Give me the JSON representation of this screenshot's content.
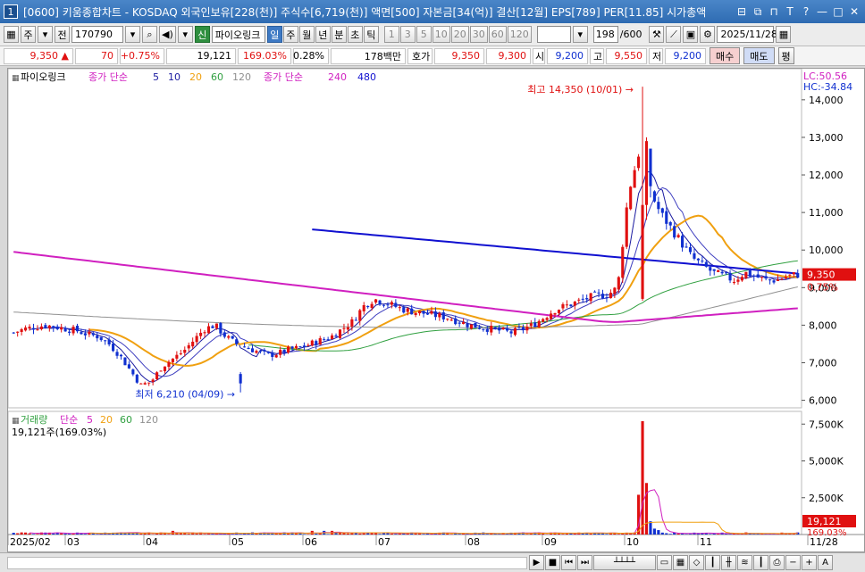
{
  "window": {
    "number": "1",
    "title": "[0600] 키움종합차트 - KOSDAQ 외국인보유[228(천)] 주식수[6,719(천)] 액면[500] 자본금[34(억)] 결산[12월] EPS[789] PER[11.85] 시가총액",
    "buttons": [
      "⊟",
      "⧉",
      "⊓",
      "T",
      "?",
      "—",
      "□",
      "✕"
    ]
  },
  "toolbar": {
    "market_btn": "주",
    "prev_btn": "전",
    "stock_code": "170790",
    "badge_new": "신",
    "stock_name": "파이오링크",
    "periods": [
      "일",
      "주",
      "월",
      "년",
      "분",
      "초",
      "틱"
    ],
    "selected_period": "일",
    "intervals": [
      "1",
      "3",
      "5",
      "10",
      "20",
      "30",
      "60",
      "120"
    ],
    "count_display": "198",
    "count_total": "/600",
    "date_value": "2025/11/28"
  },
  "quote": {
    "price": "9,350",
    "arrow": "▲",
    "change": "70",
    "change_pct": "+0.75%",
    "volume": "19,121",
    "vol_ratio": "169.03%",
    "turnover": "0.28%",
    "amount": "178백만",
    "hoga_label": "호가",
    "ask": "9,350",
    "bid": "9,300",
    "open_label": "시",
    "open": "9,200",
    "high_label": "고",
    "high": "9,550",
    "low_label": "저",
    "low": "9,200",
    "buy_btn": "매수",
    "sell_btn": "매도",
    "eval_btn": "평"
  },
  "price_panel": {
    "legend_name": "파이오링크",
    "legend_ma_label1": "종가 단순",
    "ma_periods1": [
      "5",
      "10",
      "20",
      "60",
      "120"
    ],
    "legend_ma_label2": "종가 단순",
    "ma_periods2": [
      "240",
      "480"
    ],
    "lc": "LC:50.56",
    "hc": "HC:-34.84",
    "high_annot": "최고 14,350 (10/01)",
    "low_annot": "최저 6,210 (04/09)",
    "y_ticks": [
      "14,000",
      "13,000",
      "12,000",
      "11,000",
      "10,000",
      "9,000",
      "8,000",
      "7,000",
      "6,000"
    ],
    "last_price_tag": "9,350",
    "last_pct_tag": "0.75%"
  },
  "volume_panel": {
    "legend_name": "거래량",
    "legend_ma_label": "단순",
    "ma_periods": [
      "5",
      "20",
      "60",
      "120"
    ],
    "current_vol": "19,121주(169.03%)",
    "y_ticks": [
      "7,500K",
      "5,000K",
      "2,500K"
    ],
    "last_vol_tag": "19,121",
    "last_pct_tag": "169.03%"
  },
  "x_axis": {
    "labels": [
      "2025/02",
      "03",
      "04",
      "05",
      "06",
      "07",
      "08",
      "09",
      "10",
      "11",
      "11/28"
    ]
  },
  "colors": {
    "up": "#e01010",
    "down": "#1030d0",
    "ma5": "#1a1aa0",
    "ma10": "#1a1aa0",
    "ma20": "#f0a010",
    "ma60": "#30a040",
    "ma120": "#909090",
    "ma240": "#d020c0",
    "ma480": "#1010d0"
  },
  "chart_data": {
    "type": "candlestick",
    "y_range": [
      5800,
      14400
    ],
    "series_close_approx": [
      7800,
      7900,
      7950,
      8000,
      7950,
      7900,
      7850,
      7750,
      7700,
      7500,
      7200,
      6800,
      6400,
      6500,
      6900,
      7100,
      7300,
      7600,
      7900,
      8000,
      7700,
      7500,
      7400,
      7300,
      7200,
      7250,
      7350,
      7400,
      7500,
      7600,
      7700,
      7900,
      8100,
      8500,
      8700,
      8600,
      8500,
      8400,
      8350,
      8300,
      8250,
      8200,
      8100,
      8000,
      7950,
      7900,
      7850,
      7800,
      7900,
      8000,
      8200,
      8400,
      8500,
      8600,
      8700,
      8800,
      8800,
      9000,
      11500,
      12600,
      11600,
      11000,
      10600,
      10200,
      9800,
      9600,
      9400,
      9300,
      9200,
      9400,
      9300,
      9200,
      9200,
      9300,
      9350
    ],
    "volume_highlights": {
      "peak_date": "10/01",
      "peak_value_k": 7700
    }
  }
}
